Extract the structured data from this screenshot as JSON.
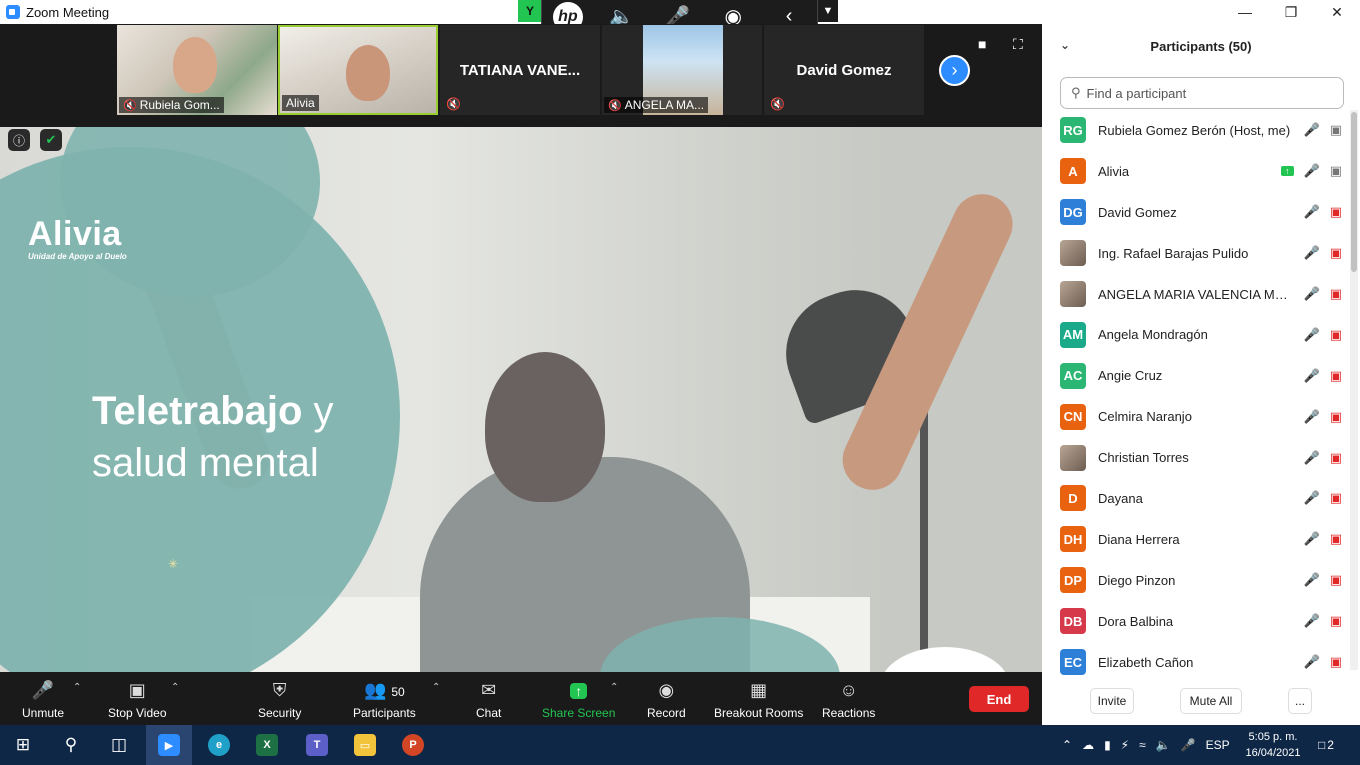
{
  "window": {
    "title": "Zoom Meeting"
  },
  "hp_toolbar": {
    "green_label": "Y",
    "brand": "hp"
  },
  "thumbnails": [
    {
      "name": "Rubiela Gom..."
    },
    {
      "name": "Alivia"
    },
    {
      "name": "TATIANA VANE..."
    },
    {
      "name": "ANGELA MA..."
    },
    {
      "name": "David Gomez"
    }
  ],
  "slide": {
    "brand": "Alivia",
    "brand_sub": "Unidad de Apoyo al Duelo",
    "headline_bold": "Teletrabajo",
    "headline_rest": " y",
    "headline_line2": "salud mental"
  },
  "toolbar": {
    "unmute": "Unmute",
    "stop_video": "Stop Video",
    "security": "Security",
    "participants": "Participants",
    "participants_count": "50",
    "chat": "Chat",
    "share_screen": "Share Screen",
    "record": "Record",
    "breakout_rooms": "Breakout Rooms",
    "reactions": "Reactions",
    "end": "End"
  },
  "panel": {
    "title": "Participants (50)",
    "search_placeholder": "Find a participant",
    "invite": "Invite",
    "mute_all": "Mute All",
    "more": "..."
  },
  "participants": [
    {
      "initials": "RG",
      "name": "Rubiela Gomez Berón (Host, me)",
      "color": "#2bb673",
      "photo": false,
      "state": "host"
    },
    {
      "initials": "A",
      "name": "Alivia",
      "color": "#e8620f",
      "photo": false,
      "state": "sharing"
    },
    {
      "initials": "DG",
      "name": "David Gomez",
      "color": "#2d7fd8",
      "photo": false,
      "state": "off"
    },
    {
      "initials": "",
      "name": "Ing. Rafael Barajas Pulido",
      "color": "#7a6a5e",
      "photo": true,
      "state": "off"
    },
    {
      "initials": "",
      "name": "ANGELA MARIA VALENCIA MAR...",
      "color": "#9a8a7e",
      "photo": true,
      "state": "off"
    },
    {
      "initials": "AM",
      "name": "Angela Mondragón",
      "color": "#1aaa8a",
      "photo": false,
      "state": "off"
    },
    {
      "initials": "AC",
      "name": "Angie Cruz",
      "color": "#2bb673",
      "photo": false,
      "state": "off"
    },
    {
      "initials": "CN",
      "name": "Celmira Naranjo",
      "color": "#e8620f",
      "photo": false,
      "state": "off"
    },
    {
      "initials": "",
      "name": "Christian Torres",
      "color": "#8a7a6e",
      "photo": true,
      "state": "off"
    },
    {
      "initials": "D",
      "name": "Dayana",
      "color": "#e8620f",
      "photo": false,
      "state": "off"
    },
    {
      "initials": "DH",
      "name": "Diana Herrera",
      "color": "#e8620f",
      "photo": false,
      "state": "off"
    },
    {
      "initials": "DP",
      "name": "Diego Pinzon",
      "color": "#e8620f",
      "photo": false,
      "state": "off"
    },
    {
      "initials": "DB",
      "name": "Dora Balbina",
      "color": "#d6394a",
      "photo": false,
      "state": "off"
    },
    {
      "initials": "EC",
      "name": "Elizabeth Cañon",
      "color": "#2d7fd8",
      "photo": false,
      "state": "off"
    }
  ],
  "taskbar": {
    "language": "ESP",
    "time": "5:05 p. m.",
    "date": "16/04/2021",
    "notifications": "2"
  },
  "colors": {
    "zoom_blue": "#2d8cff",
    "end_red": "#e02828",
    "share_green": "#23c552",
    "slide_teal": "#7fb3ae"
  }
}
